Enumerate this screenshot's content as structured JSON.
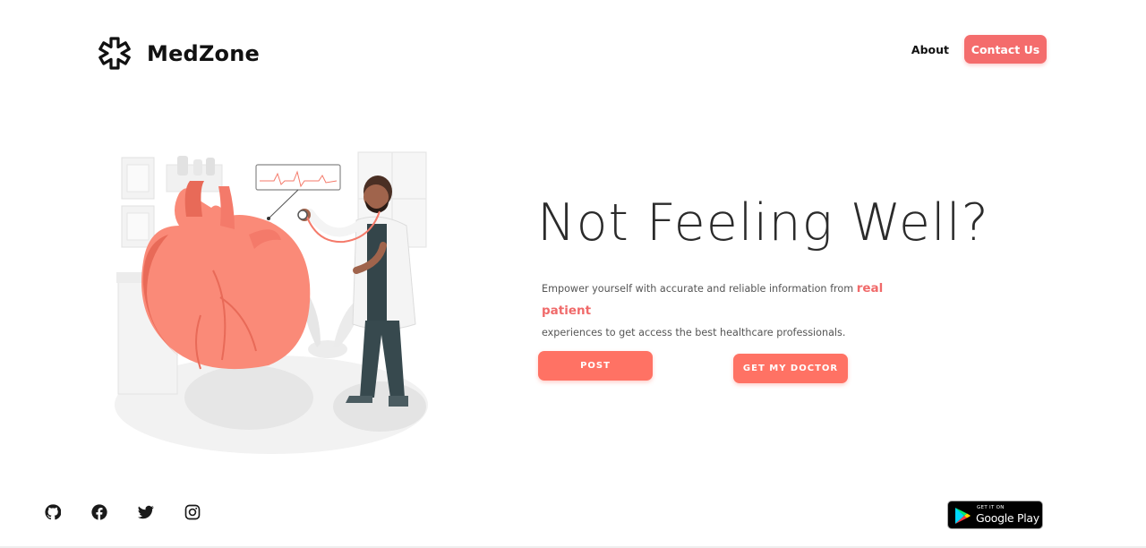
{
  "header": {
    "brand": "MedZone",
    "nav_about": "About",
    "contact_label": "Contact Us"
  },
  "hero": {
    "title": "Not Feeling Well?",
    "subtitle_before": "Empower yourself with accurate and reliable information from",
    "subtitle_highlight": "real patient",
    "subtitle_after": "experiences to get access the best healthcare professionals.",
    "post_label": "POST",
    "doctor_label": "GET MY DOCTOR"
  },
  "footer": {
    "social_icons": [
      "github-icon",
      "facebook-icon",
      "twitter-icon",
      "instagram-icon"
    ],
    "play_small": "GET IT ON",
    "play_big": "Google Play"
  },
  "colors": {
    "accent": "#f46c6c",
    "button": "#ff7264",
    "heart": "#fa8a78",
    "heart_dark": "#e86a58",
    "ink": "#2b2b2b"
  }
}
